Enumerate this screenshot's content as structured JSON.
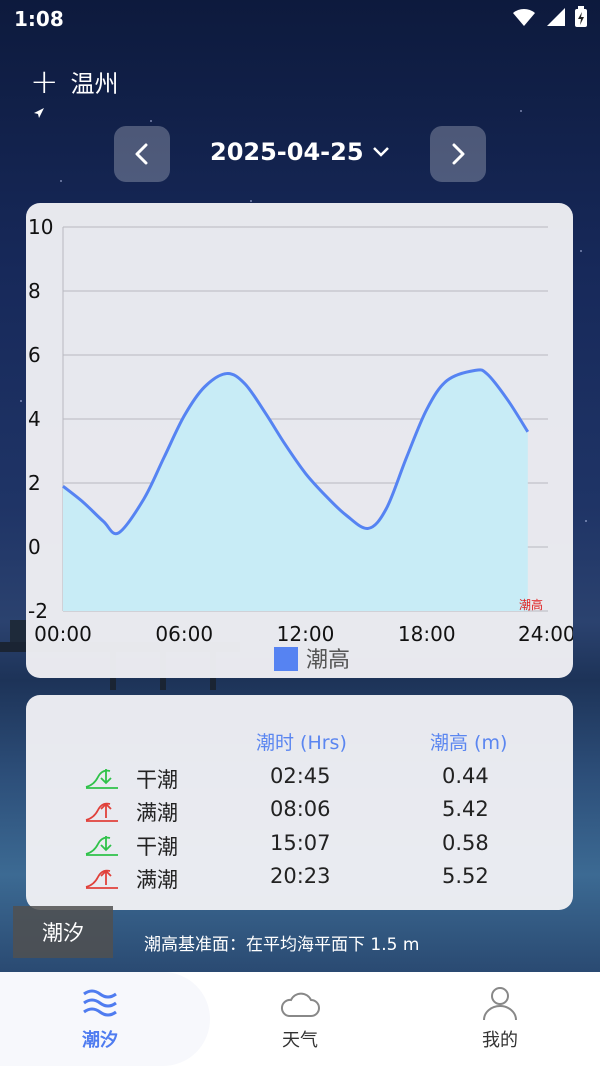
{
  "status_bar": {
    "time": "1:08"
  },
  "header": {
    "city": "温州",
    "date": "2025-04-25"
  },
  "chart_data": {
    "type": "area",
    "title": "",
    "xlabel": "",
    "ylabel": "",
    "x_ticks": [
      "00:00",
      "06:00",
      "12:00",
      "18:00",
      "24:00"
    ],
    "y_ticks": [
      10,
      8,
      6,
      4,
      2,
      0,
      -2
    ],
    "ylim": [
      -2,
      10
    ],
    "xlim": [
      0,
      23
    ],
    "grid": true,
    "legend_position": "bottom",
    "series": [
      {
        "name": "潮高",
        "x": [
          0,
          1,
          2,
          2.75,
          4,
          5,
          6,
          7,
          8.1,
          9,
          10,
          11,
          12,
          13,
          14,
          15.1,
          16,
          17,
          18,
          19,
          20.4,
          21,
          22,
          23
        ],
        "values": [
          1.9,
          1.4,
          0.8,
          0.44,
          1.5,
          2.8,
          4.1,
          5.0,
          5.42,
          5.1,
          4.2,
          3.2,
          2.3,
          1.6,
          1.0,
          0.58,
          1.2,
          2.8,
          4.3,
          5.2,
          5.52,
          5.4,
          4.6,
          3.6
        ]
      }
    ],
    "colors": {
      "line": "#5683f2",
      "fill": "#c8ecf6",
      "legend": "#5683f2",
      "corner_label": "#e02020"
    }
  },
  "table": {
    "headers": {
      "time": "潮时 (Hrs)",
      "height": "潮高 (m)"
    },
    "rows": [
      {
        "type": "干潮",
        "time": "02:45",
        "height": "0.44",
        "icon": "low-tide-icon"
      },
      {
        "type": "满潮",
        "time": "08:06",
        "height": "5.42",
        "icon": "high-tide-icon"
      },
      {
        "type": "干潮",
        "time": "15:07",
        "height": "0.58",
        "icon": "low-tide-icon"
      },
      {
        "type": "满潮",
        "time": "20:23",
        "height": "5.52",
        "icon": "high-tide-icon"
      }
    ]
  },
  "footer": {
    "tag": "潮汐",
    "datum": "潮高基准面：在平均海平面下 1.5 m"
  },
  "tabbar": {
    "items": [
      {
        "label": "潮汐",
        "icon": "waves-icon",
        "active": true
      },
      {
        "label": "天气",
        "icon": "cloud-icon",
        "active": false
      },
      {
        "label": "我的",
        "icon": "person-icon",
        "active": false
      }
    ]
  },
  "theme": {
    "accent": "#4f7cf0",
    "low_tide": "#2fc24a",
    "high_tide": "#e0413b"
  }
}
